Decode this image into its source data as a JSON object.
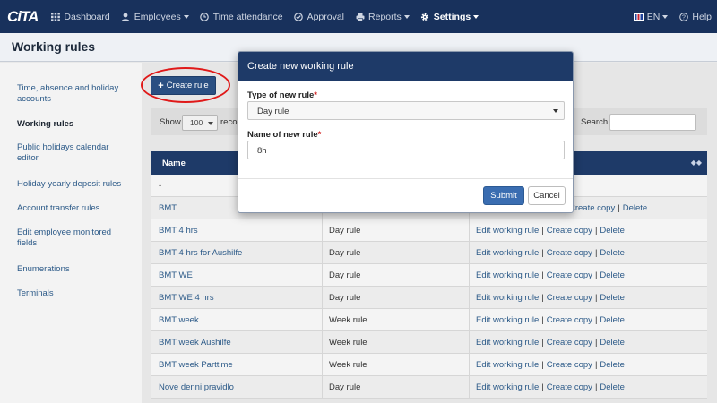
{
  "app": {
    "logo_text": "CiTA",
    "colors": {
      "navbar": "#18315c",
      "table_header": "#1e3a68",
      "link": "#2c5a88",
      "primary_button": "#3a6db1",
      "required": "#d01818",
      "highlight_circle": "#e01919"
    }
  },
  "nav": {
    "items": [
      {
        "label": "Dashboard",
        "icon": "grid-icon"
      },
      {
        "label": "Employees",
        "icon": "user-icon",
        "dropdown": true
      },
      {
        "label": "Time attendance",
        "icon": "clock-icon"
      },
      {
        "label": "Approval",
        "icon": "check-circle-icon"
      },
      {
        "label": "Reports",
        "icon": "printer-icon",
        "dropdown": true
      },
      {
        "label": "Settings",
        "icon": "gear-icon",
        "dropdown": true,
        "active": true
      }
    ],
    "language": "EN",
    "help": "Help"
  },
  "page": {
    "title": "Working rules"
  },
  "sidebar": {
    "items": [
      {
        "label": "Time, absence and holiday accounts"
      },
      {
        "label": "Working rules",
        "active": true
      },
      {
        "label": "Public holidays calendar editor"
      },
      {
        "label": "Holiday yearly deposit rules"
      },
      {
        "label": "Account transfer rules"
      },
      {
        "label": "Edit employee monitored fields"
      },
      {
        "label": "Enumerations"
      },
      {
        "label": "Terminals"
      }
    ]
  },
  "toolbar": {
    "create_label": "Create rule"
  },
  "table_controls": {
    "show_label": "Show",
    "page_size": "100",
    "records_label": "reco",
    "search_label": "Search",
    "search_value": ""
  },
  "table": {
    "columns": [
      "Name"
    ],
    "rows": [
      {
        "name": "-",
        "type": "",
        "actions": []
      },
      {
        "name": "BMT",
        "type": "",
        "actions": [
          "Create copy",
          "Delete"
        ]
      },
      {
        "name": "BMT 4 hrs",
        "type": "Day rule",
        "actions": [
          "Edit working rule",
          "Create copy",
          "Delete"
        ]
      },
      {
        "name": "BMT 4 hrs for Aushilfe",
        "type": "Day rule",
        "actions": [
          "Edit working rule",
          "Create copy",
          "Delete"
        ]
      },
      {
        "name": "BMT WE",
        "type": "Day rule",
        "actions": [
          "Edit working rule",
          "Create copy",
          "Delete"
        ]
      },
      {
        "name": "BMT WE 4 hrs",
        "type": "Day rule",
        "actions": [
          "Edit working rule",
          "Create copy",
          "Delete"
        ]
      },
      {
        "name": "BMT week",
        "type": "Week rule",
        "actions": [
          "Edit working rule",
          "Create copy",
          "Delete"
        ]
      },
      {
        "name": "BMT week Aushilfe",
        "type": "Week rule",
        "actions": [
          "Edit working rule",
          "Create copy",
          "Delete"
        ]
      },
      {
        "name": "BMT week Parttime",
        "type": "Week rule",
        "actions": [
          "Edit working rule",
          "Create copy",
          "Delete"
        ]
      },
      {
        "name": "Nove denni pravidlo",
        "type": "Day rule",
        "actions": [
          "Edit working rule",
          "Create copy",
          "Delete"
        ]
      }
    ]
  },
  "modal": {
    "title": "Create new working rule",
    "type_label": "Type of new rule",
    "type_value": "Day rule",
    "name_label": "Name of new rule",
    "name_value": "8h",
    "required_mark": "*",
    "submit_label": "Submit",
    "cancel_label": "Cancel"
  }
}
